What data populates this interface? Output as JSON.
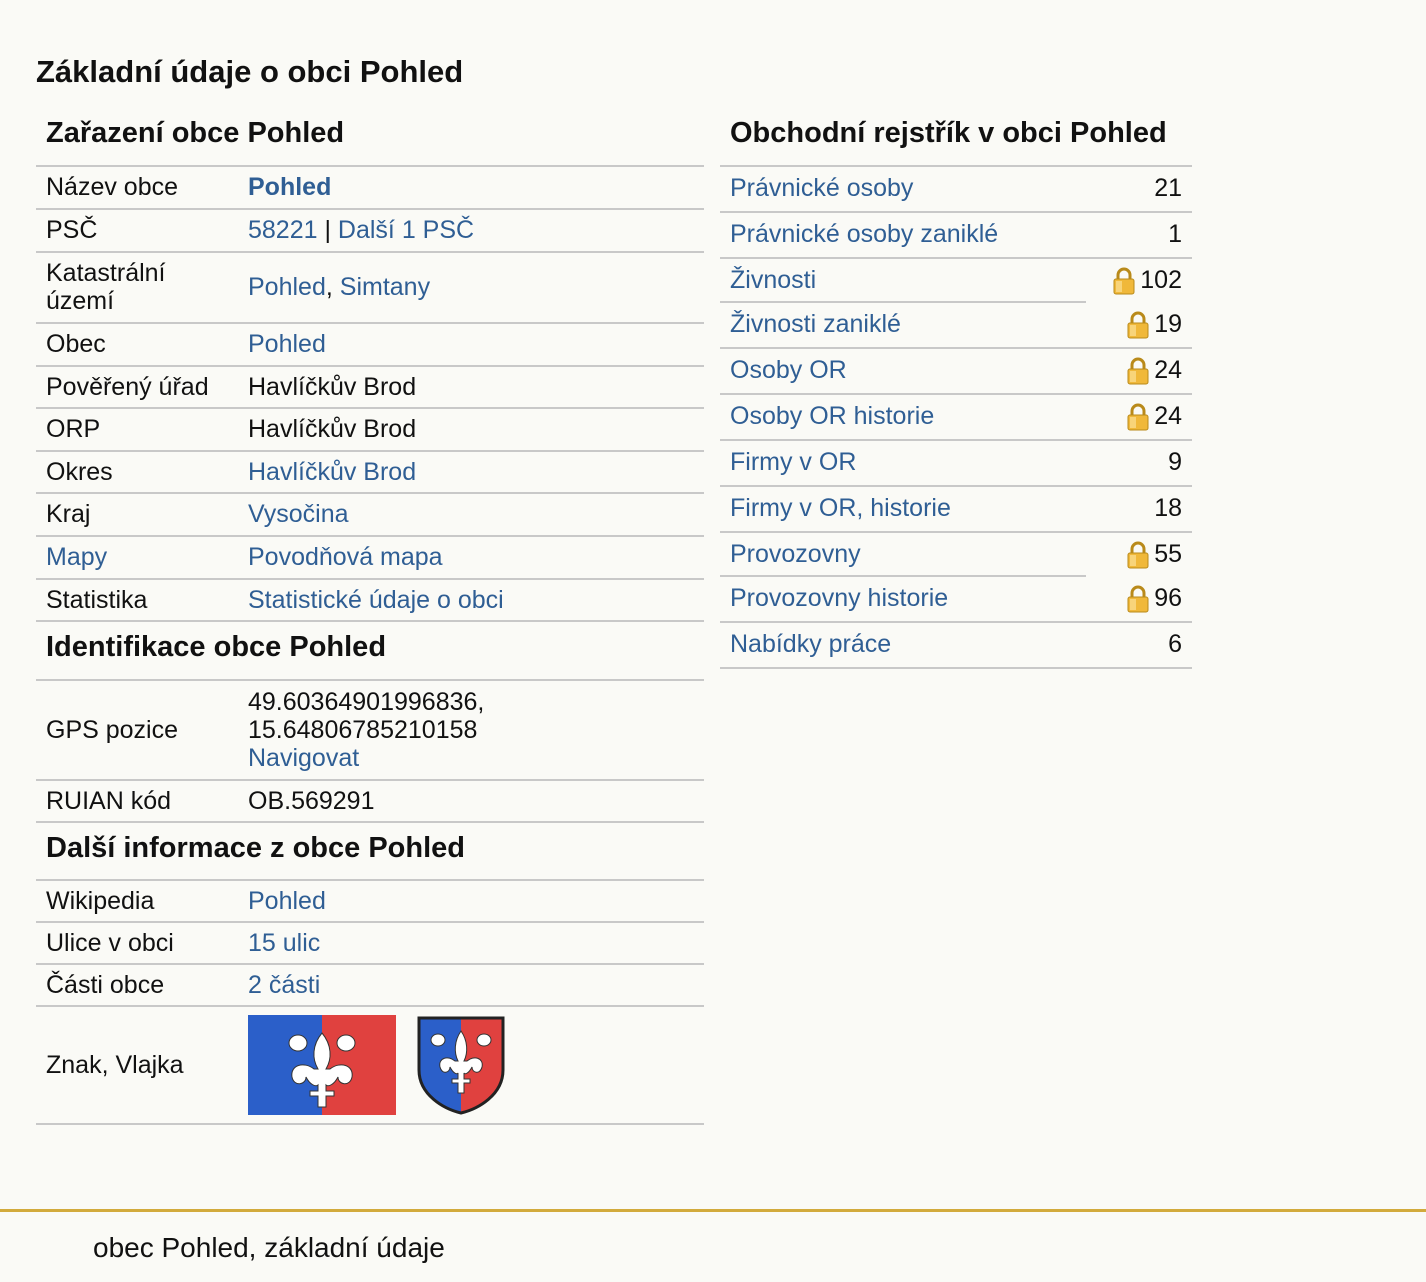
{
  "page_title": "Základní údaje o obci Pohled",
  "left": {
    "zarazeni": {
      "title": "Zařazení obce Pohled",
      "nazev_label": "Název obce",
      "nazev_value": "Pohled",
      "psc_label": "PSČ",
      "psc_link": "58221",
      "psc_sep": " | ",
      "psc_more": "Další 1 PSČ",
      "ku_label": "Katastrální území",
      "ku_link1": "Pohled",
      "ku_sep": ", ",
      "ku_link2": "Simtany",
      "obec_label": "Obec",
      "obec_value": "Pohled",
      "pou_label": "Pověřený úřad",
      "pou_value": "Havlíčkův Brod",
      "orp_label": "ORP",
      "orp_value": "Havlíčkův Brod",
      "okres_label": "Okres",
      "okres_value": "Havlíčkův Brod",
      "kraj_label": "Kraj",
      "kraj_value": "Vysočina",
      "mapy_label": "Mapy",
      "mapy_value": "Povodňová mapa",
      "stat_label": "Statistika",
      "stat_value": "Statistické údaje o obci"
    },
    "identifikace": {
      "title": "Identifikace obce Pohled",
      "gps_label": "GPS pozice",
      "gps_lat": "49.60364901996836,",
      "gps_lon": "15.64806785210158",
      "gps_nav": "Navigovat",
      "ruian_label": "RUIAN kód",
      "ruian_value": "OB.569291"
    },
    "dalsi": {
      "title": "Další informace z obce Pohled",
      "wiki_label": "Wikipedia",
      "wiki_value": "Pohled",
      "ulice_label": "Ulice v obci",
      "ulice_value": "15 ulic",
      "casti_label": "Části obce",
      "casti_value": "2 části",
      "znak_label": "Znak, Vlajka"
    }
  },
  "right": {
    "title": "Obchodní rejstřík v obci Pohled",
    "rows": [
      {
        "label": "Právnické osoby",
        "value": "21"
      },
      {
        "label": "Právnické osoby zaniklé",
        "value": "1"
      },
      {
        "label": "Živnosti",
        "value": "102"
      },
      {
        "label": "Živnosti zaniklé",
        "value": "19"
      },
      {
        "label": "Osoby OR",
        "value": "24"
      },
      {
        "label": "Osoby OR historie",
        "value": "24"
      },
      {
        "label": "Firmy v OR",
        "value": "9"
      },
      {
        "label": "Firmy v OR, historie",
        "value": "18"
      },
      {
        "label": "Provozovny",
        "value": "55"
      },
      {
        "label": "Provozovny historie",
        "value": "96"
      },
      {
        "label": "Nabídky práce",
        "value": "6"
      }
    ]
  },
  "footer": {
    "text": "obec Pohled, základní údaje"
  },
  "colors": {
    "link": "#2f5e94",
    "border": "#c8c8c8",
    "footer_line": "#d2aa3c",
    "flag_blue": "#2b5fc9",
    "flag_red": "#e0413f"
  }
}
